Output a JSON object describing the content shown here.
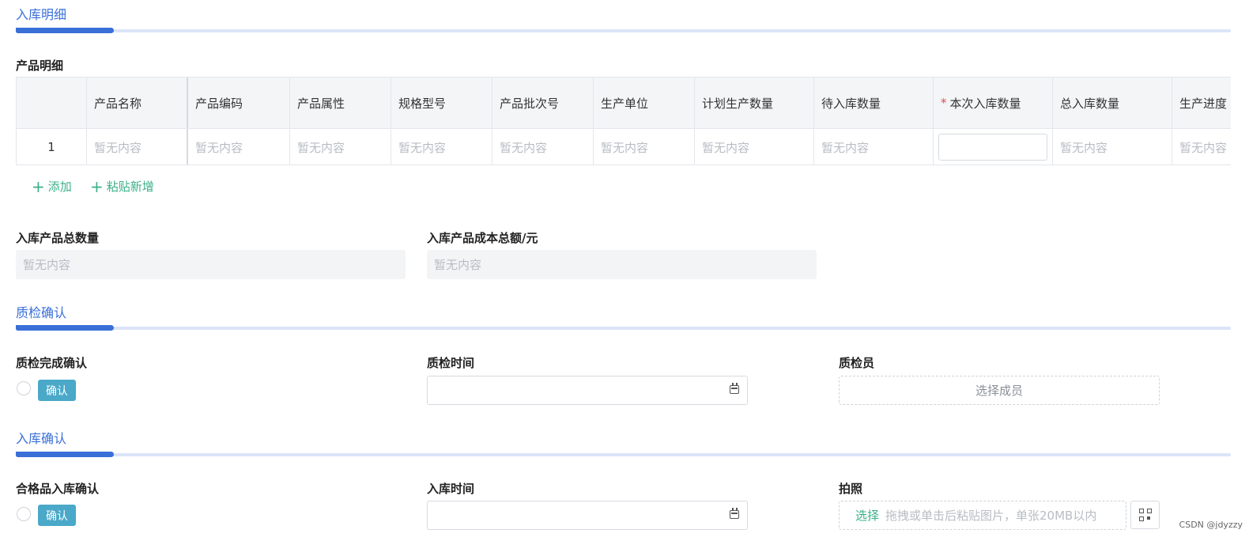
{
  "sections": {
    "inbound_detail": "入库明细",
    "qc_confirm": "质检确认",
    "inbound_confirm": "入库确认"
  },
  "product_detail": {
    "title": "产品明细",
    "columns": [
      "",
      "产品名称",
      "产品编码",
      "产品属性",
      "规格型号",
      "产品批次号",
      "生产单位",
      "计划生产数量",
      "待入库数量",
      "本次入库数量",
      "总入库数量",
      "生产进度"
    ],
    "required_column": "*",
    "rows": [
      {
        "index": "1",
        "cells": [
          "暂无内容",
          "暂无内容",
          "暂无内容",
          "暂无内容",
          "暂无内容",
          "暂无内容",
          "暂无内容",
          "暂无内容",
          "",
          "暂无内容",
          "暂无内容"
        ]
      }
    ],
    "add_label": "添加",
    "paste_add_label": "粘贴新增"
  },
  "totals": {
    "total_qty_label": "入库产品总数量",
    "total_qty_value": "暂无内容",
    "total_cost_label": "入库产品成本总额/元",
    "total_cost_value": "暂无内容"
  },
  "qc": {
    "complete_label": "质检完成确认",
    "confirm_tag": "确认",
    "time_label": "质检时间",
    "time_value": "",
    "inspector_label": "质检员",
    "inspector_placeholder": "选择成员"
  },
  "inbound": {
    "qualified_label": "合格品入库确认",
    "confirm_tag": "确认",
    "time_label": "入库时间",
    "time_value": "",
    "photo_label": "拍照",
    "upload_select": "选择",
    "upload_hint": "拖拽或单击后粘贴图片，单张20MB以内"
  },
  "watermark": "CSDN @jdyzzy",
  "colors": {
    "accent": "#3a6fd8",
    "green": "#3bb08a",
    "tag": "#4aa8c8",
    "required": "#e5484d"
  },
  "icons": {
    "date": "calendar-icon",
    "qr": "qr-code-icon",
    "add": "plus-icon"
  }
}
